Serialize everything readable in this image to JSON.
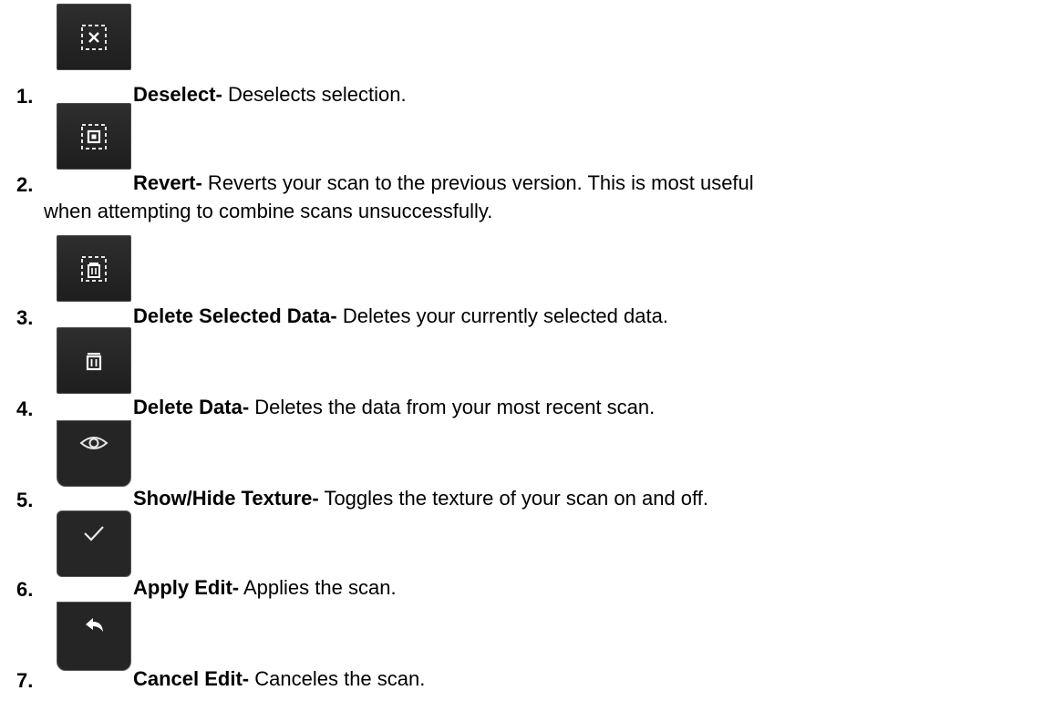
{
  "items": [
    {
      "number": "1.",
      "term": "Deselect-",
      "desc": " Deselects selection.",
      "icon": "deselect-icon"
    },
    {
      "number": "2.",
      "term": "Revert-",
      "desc": " Reverts your scan to the previous version. This is most useful",
      "desc2": "when attempting to combine scans unsuccessfully.",
      "icon": "revert-icon"
    },
    {
      "number": "3.",
      "term": "Delete Selected Data-",
      "desc": " Deletes your currently selected data.",
      "icon": "delete-selected-icon"
    },
    {
      "number": "4.",
      "term": "Delete Data-",
      "desc": " Deletes the data from your most recent scan.",
      "icon": "trash-icon"
    },
    {
      "number": "5.",
      "term": "Show/Hide Texture-",
      "desc": " Toggles the texture of your scan on and off.",
      "icon": "eye-icon"
    },
    {
      "number": "6.",
      "term": "Apply Edit-",
      "desc": " Applies the scan.",
      "icon": "checkmark-icon"
    },
    {
      "number": "7.",
      "term": "Cancel Edit-",
      "desc": " Canceles the scan.",
      "icon": "undo-arrow-icon"
    }
  ],
  "colors": {
    "button_bg": "#252525",
    "button_border": "#4a4a4a",
    "icon_fg": "#e6e6e6",
    "text": "#000000"
  }
}
